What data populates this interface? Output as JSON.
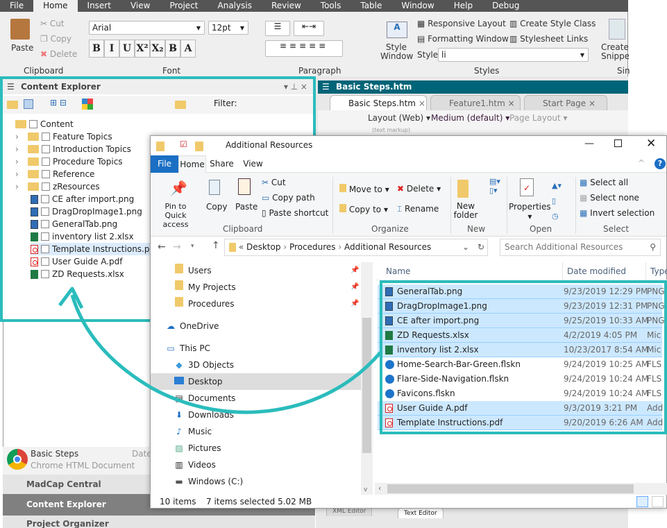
{
  "flare": {
    "menu": [
      "File",
      "Home",
      "Insert",
      "View",
      "Project",
      "Analysis",
      "Review",
      "Tools",
      "Table",
      "Window",
      "Help",
      "Debug"
    ],
    "active_menu": "Home",
    "clipboard": {
      "paste": "Paste",
      "cut": "Cut",
      "copy": "Copy",
      "delete": "Delete",
      "label": "Clipboard"
    },
    "font": {
      "family": "Arial",
      "size": "12pt",
      "label": "Font",
      "buttons": [
        "B",
        "I",
        "U",
        "X²",
        "X₂",
        "B̶",
        "A"
      ]
    },
    "paragraph": {
      "label": "Paragraph"
    },
    "styles": {
      "style_window": "Style Window",
      "responsive": "Responsive Layout",
      "formatting": "Formatting Window",
      "create_class": "Create Style Class",
      "stylesheet_links": "Stylesheet Links",
      "style_label": "Style",
      "style_value": "li",
      "label": "Styles"
    },
    "snippet": {
      "create": "Create Snippet",
      "label": "Sin"
    },
    "content_explorer": {
      "title": "Content Explorer",
      "filter_label": "Filter:",
      "root": "Content",
      "folders": [
        "Feature Topics",
        "Introduction Topics",
        "Procedure Topics",
        "Reference",
        "zResources"
      ],
      "files": [
        {
          "name": "CE after import.png",
          "type": "img"
        },
        {
          "name": "DragDropImage1.png",
          "type": "img"
        },
        {
          "name": "GeneralTab.png",
          "type": "img"
        },
        {
          "name": "inventory list 2.xlsx",
          "type": "xls"
        },
        {
          "name": "Template Instructions.pdf",
          "type": "pdf",
          "selected": true
        },
        {
          "name": "User Guide A.pdf",
          "type": "pdf"
        },
        {
          "name": "ZD Requests.xlsx",
          "type": "xls"
        }
      ]
    },
    "editor": {
      "title": "Basic Steps.htm",
      "tabs": [
        "Basic Steps.htm",
        "Feature1.htm",
        "Start Page"
      ],
      "layout": "Layout (Web)",
      "medium": "Medium (default)",
      "page_layout": "Page Layout",
      "text_markup": "(text markup)",
      "bottom_tabs": [
        "XML Editor",
        "Text Editor"
      ]
    },
    "left_bottom": {
      "doc_name": "Basic Steps",
      "doc_type": "Chrome HTML Document",
      "date_label": "Date",
      "madcap_central": "MadCap Central",
      "content_explorer": "Content Explorer",
      "project_organizer": "Project Organizer"
    }
  },
  "explorer": {
    "title": "Additional Resources",
    "tabs": [
      "File",
      "Home",
      "Share",
      "View"
    ],
    "ribbon": {
      "pin": "Pin to Quick access",
      "copy": "Copy",
      "paste": "Paste",
      "cut": "Cut",
      "copy_path": "Copy path",
      "paste_shortcut": "Paste shortcut",
      "clipboard": "Clipboard",
      "move_to": "Move to",
      "copy_to": "Copy to",
      "delete": "Delete",
      "rename": "Rename",
      "organize": "Organize",
      "new_folder": "New folder",
      "new": "New",
      "properties": "Properties",
      "open": "Open",
      "select_all": "Select all",
      "select_none": "Select none",
      "invert": "Invert selection",
      "select": "Select"
    },
    "breadcrumb": [
      "Desktop",
      "Procedures",
      "Additional Resources"
    ],
    "search_placeholder": "Search Additional Resources",
    "nav": [
      {
        "label": "Users",
        "icon": "folder-icon",
        "pinned": true
      },
      {
        "label": "My Projects",
        "icon": "folder-icon",
        "pinned": true
      },
      {
        "label": "Procedures",
        "icon": "folder-icon",
        "pinned": true
      },
      {
        "label": "OneDrive",
        "icon": "cloud-icon"
      },
      {
        "label": "This PC",
        "icon": "computer-icon"
      },
      {
        "label": "3D Objects",
        "icon": "cube-icon"
      },
      {
        "label": "Desktop",
        "icon": "desktop-icon",
        "selected": true
      },
      {
        "label": "Documents",
        "icon": "document-icon"
      },
      {
        "label": "Downloads",
        "icon": "download-icon"
      },
      {
        "label": "Music",
        "icon": "music-icon"
      },
      {
        "label": "Pictures",
        "icon": "picture-icon"
      },
      {
        "label": "Videos",
        "icon": "video-icon"
      },
      {
        "label": "Windows (C:)",
        "icon": "drive-icon"
      }
    ],
    "columns": [
      "Name",
      "Date modified",
      "Type"
    ],
    "files": [
      {
        "name": "GeneralTab.png",
        "date": "9/23/2019 12:29 PM",
        "type": "PNG",
        "kind": "img",
        "selected": true
      },
      {
        "name": "DragDropImage1.png",
        "date": "9/23/2019 12:31 PM",
        "type": "PNG",
        "kind": "img",
        "selected": true
      },
      {
        "name": "CE after import.png",
        "date": "9/25/2019 10:33 AM",
        "type": "PNG",
        "kind": "img",
        "selected": true
      },
      {
        "name": "ZD Requests.xlsx",
        "date": "4/2/2019 4:05 PM",
        "type": "Mic",
        "kind": "xls",
        "selected": true
      },
      {
        "name": "inventory list 2.xlsx",
        "date": "10/23/2017 8:54 AM",
        "type": "Mic",
        "kind": "xls",
        "selected": true
      },
      {
        "name": "Home-Search-Bar-Green.flskn",
        "date": "9/24/2019 10:25 AM",
        "type": "FLS",
        "kind": "sk",
        "selected": false
      },
      {
        "name": "Flare-Side-Navigation.flskn",
        "date": "9/24/2019 10:24 AM",
        "type": "FLS",
        "kind": "sk",
        "selected": false
      },
      {
        "name": "Favicons.flskn",
        "date": "9/24/2019 10:24 AM",
        "type": "FLS",
        "kind": "sk",
        "selected": false
      },
      {
        "name": "User Guide A.pdf",
        "date": "9/3/2019 3:21 PM",
        "type": "Add",
        "kind": "pdf",
        "selected": true
      },
      {
        "name": "Template Instructions.pdf",
        "date": "9/20/2019 6:26 AM",
        "type": "Add",
        "kind": "pdf",
        "selected": true
      }
    ],
    "status": {
      "items": "10 items",
      "selected": "7 items selected  5.02 MB"
    }
  },
  "colors": {
    "highlight": "#2bbcbc",
    "menubar": "#555555",
    "editor_header": "#006478",
    "selection": "#cce8ff",
    "file_tab": "#1a6fc4"
  }
}
